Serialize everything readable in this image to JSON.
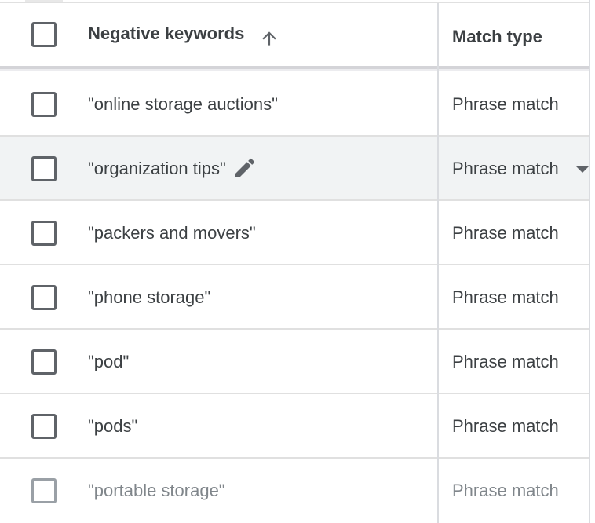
{
  "header": {
    "keyword_label": "Negative keywords",
    "match_type_label": "Match type",
    "sort_icon": "arrow-up-icon"
  },
  "rows": [
    {
      "keyword": "\"online storage auctions\"",
      "match_type": "Phrase match"
    },
    {
      "keyword": "\"organization tips\"",
      "match_type": "Phrase match",
      "hovered": true,
      "icons": [
        "pencil-edit-icon",
        "dropdown-triangle-icon"
      ]
    },
    {
      "keyword": "\"packers and movers\"",
      "match_type": "Phrase match"
    },
    {
      "keyword": "\"phone storage\"",
      "match_type": "Phrase match"
    },
    {
      "keyword": "\"pod\"",
      "match_type": "Phrase match"
    },
    {
      "keyword": "\"pods\"",
      "match_type": "Phrase match"
    },
    {
      "keyword": "\"portable storage\"",
      "match_type": "Phrase match"
    }
  ],
  "colors": {
    "text": "#3c4043",
    "hover_row": "#f1f3f4",
    "divider": "#dadce0",
    "checkbox_border": "#5f6368"
  }
}
